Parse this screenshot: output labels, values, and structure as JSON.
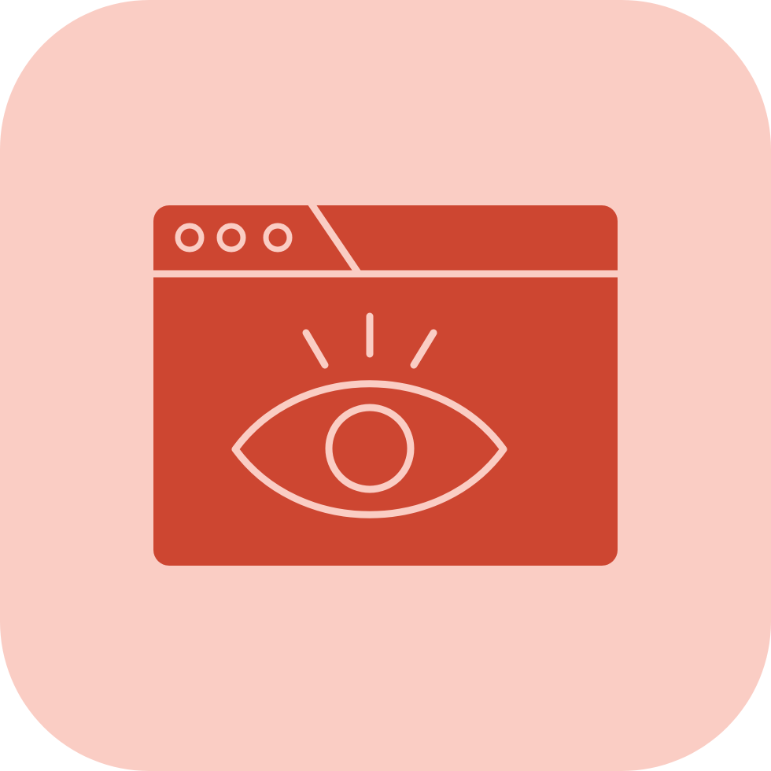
{
  "icon": {
    "name": "browser-eye-icon",
    "parts": [
      "browser-window-icon",
      "eye-icon"
    ]
  },
  "colors": {
    "tile_background": "#facdc4",
    "browser_fill": "#cd4631",
    "line_color": "#facdc4"
  }
}
